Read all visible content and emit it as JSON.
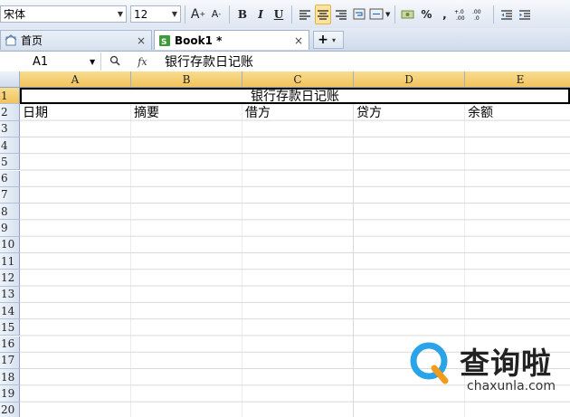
{
  "toolbar": {
    "font_name": "宋体",
    "font_size": "12",
    "grow_font": "A",
    "shrink_font": "A",
    "bold": "B",
    "italic": "I",
    "underline": "U",
    "percent": "%",
    "comma": ","
  },
  "tabs": [
    {
      "label": "首页",
      "close": "×"
    },
    {
      "label": "Book1 *",
      "close": "×"
    }
  ],
  "new_tab": {
    "plus": "+",
    "dropdown": "▾"
  },
  "formula_bar": {
    "cell_ref": "A1",
    "fx": "fx",
    "content": "银行存款日记账"
  },
  "sheet": {
    "columns": [
      "A",
      "B",
      "C",
      "D",
      "E"
    ],
    "rows": [
      "1",
      "2",
      "3",
      "4",
      "5",
      "6",
      "7",
      "8",
      "9",
      "10",
      "11",
      "12",
      "13",
      "14",
      "15",
      "16",
      "17",
      "18",
      "19",
      "20"
    ],
    "title": "银行存款日记账",
    "headers": [
      "日期",
      "摘要",
      "借方",
      "贷方",
      "余额"
    ]
  },
  "watermark": {
    "cn": "查询啦",
    "en": "chaxunla.com"
  },
  "colors": {
    "selected_header": "#f1c35c",
    "logo_blue": "#2aa3e8",
    "logo_orange": "#f49a1c"
  }
}
